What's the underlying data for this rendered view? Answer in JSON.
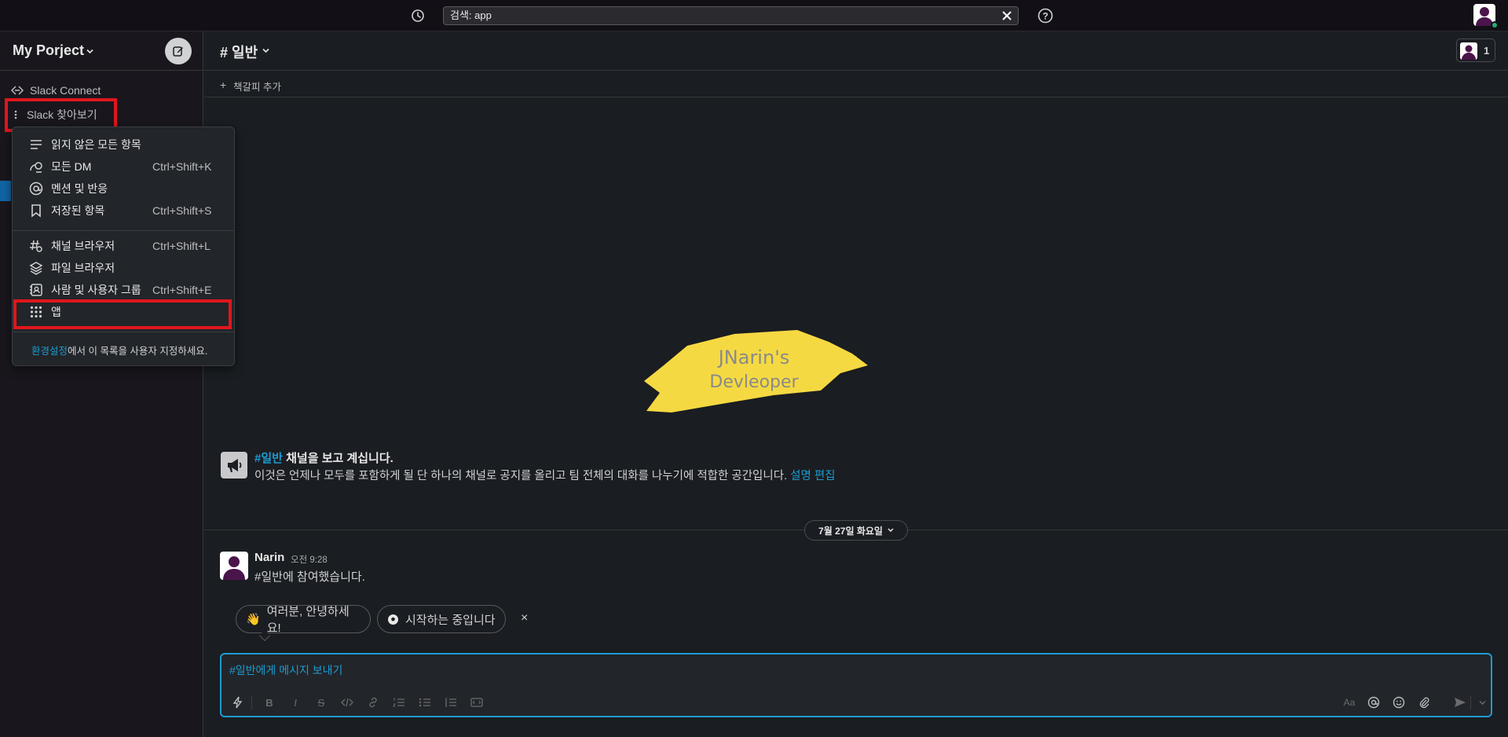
{
  "topbar": {
    "search_value": "검색: app",
    "history_icon": "clock-icon",
    "clear_icon": "close-icon",
    "help_icon": "help-circle-icon"
  },
  "sidebar": {
    "workspace_name": "My Porject",
    "slack_connect": "Slack Connect",
    "browse_slack": "Slack 찾아보기"
  },
  "menu": {
    "items": [
      {
        "label": "읽지 않은 모든 항목",
        "shortcut": "",
        "icon": "unread-lines-icon"
      },
      {
        "label": "모든 DM",
        "shortcut": "Ctrl+Shift+K",
        "icon": "dm-icon"
      },
      {
        "label": "멘션 및 반응",
        "shortcut": "",
        "icon": "at-sign-icon"
      },
      {
        "label": "저장된 항목",
        "shortcut": "Ctrl+Shift+S",
        "icon": "bookmark-icon"
      },
      {
        "label": "채널 브라우저",
        "shortcut": "Ctrl+Shift+L",
        "icon": "channel-browser-icon"
      },
      {
        "label": "파일 브라우저",
        "shortcut": "",
        "icon": "layers-icon"
      },
      {
        "label": "사람 및 사용자 그룹",
        "shortcut": "Ctrl+Shift+E",
        "icon": "contacts-icon"
      },
      {
        "label": "앱",
        "shortcut": "",
        "icon": "apps-grid-icon"
      }
    ],
    "footer_link": "환경설정",
    "footer_text": "에서 이 목록을 사용자 지정하세요."
  },
  "channel": {
    "title": "# 일반",
    "member_count": "1",
    "bookmark_add": "책갈피 추가"
  },
  "intro": {
    "logo_line1": "JNarin's",
    "logo_line2": "Devleoper",
    "title_hash": "#일반",
    "title_rest": " 채널을 보고 계십니다.",
    "desc": "이것은 언제나 모두를 포함하게 될 단 하나의 채널로 공지를 올리고 팀 전체의 대화를 나누기에 적합한 공간입니다. ",
    "desc_link": "설명 편집"
  },
  "day_divider": "7월 27일 화요일",
  "message": {
    "author": "Narin",
    "time": "오전 9:28",
    "text": "#일반에 참여했습니다."
  },
  "chips": {
    "hello": "여러분, 안녕하세요!",
    "starting": "시작하는 중입니다"
  },
  "composer": {
    "placeholder": "#일반에게 메시지 보내기"
  },
  "colors": {
    "accent": "#1d9bd1",
    "highlight": "#e0161c",
    "logo_yellow": "#f5d942",
    "presence": "#2bac76"
  }
}
